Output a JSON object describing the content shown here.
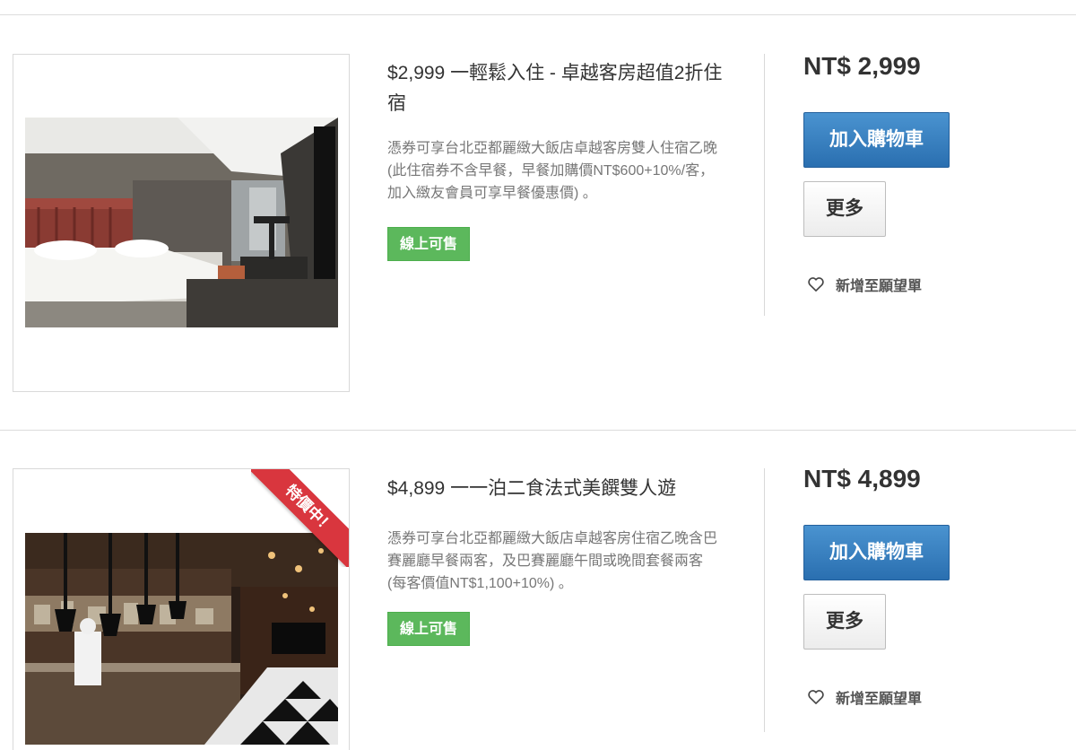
{
  "products": [
    {
      "title": "$2,999 一輕鬆入住 - 卓越客房超值2折住宿",
      "description": "憑券可享台北亞都麗緻大飯店卓越客房雙人住宿乙晚 (此住宿券不含早餐，早餐加購價NT$600+10%/客，加入緻友會員可享早餐優惠價) 。",
      "badge": "線上可售",
      "price": "NT$ 2,999",
      "cart_label": "加入購物車",
      "more_label": "更多",
      "wishlist_label": "新增至願望單"
    },
    {
      "ribbon": "特價中！",
      "title": "$4,899 一一泊二食法式美饌雙人遊",
      "description": "憑券可享台北亞都麗緻大飯店卓越客房住宿乙晚含巴賽麗廳早餐兩客，及巴賽麗廳午間或晚間套餐兩客(每客價值NT$1,100+10%) 。",
      "badge": "線上可售",
      "price": "NT$ 4,899",
      "cart_label": "加入購物車",
      "more_label": "更多",
      "wishlist_label": "新增至願望單"
    }
  ],
  "colors": {
    "cart_button": "#2f78b8",
    "badge_green": "#5cb85c",
    "ribbon_red": "#d9363e"
  },
  "icons": {
    "wishlist": "heart-outline-icon"
  }
}
